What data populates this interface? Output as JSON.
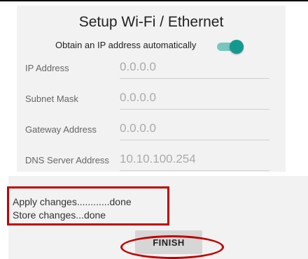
{
  "screen": {
    "title": "Setup Wi-Fi / Ethernet",
    "dhcp": {
      "label": "Obtain an IP address automatically",
      "enabled": true
    },
    "fields": [
      {
        "label": "IP Address",
        "value": "0.0.0.0"
      },
      {
        "label": "Subnet Mask",
        "value": "0.0.0.0"
      },
      {
        "label": "Gateway Address",
        "value": "0.0.0.0"
      },
      {
        "label": "DNS Server Address",
        "value": "10.10.100.254"
      }
    ]
  },
  "status": {
    "lines": [
      "Apply changes............done",
      "Store changes...done"
    ]
  },
  "actions": {
    "finish_label": "FINISH"
  },
  "colors": {
    "accent": "#139a8e",
    "accent_track": "#79c6c0",
    "highlight": "#c00000"
  }
}
